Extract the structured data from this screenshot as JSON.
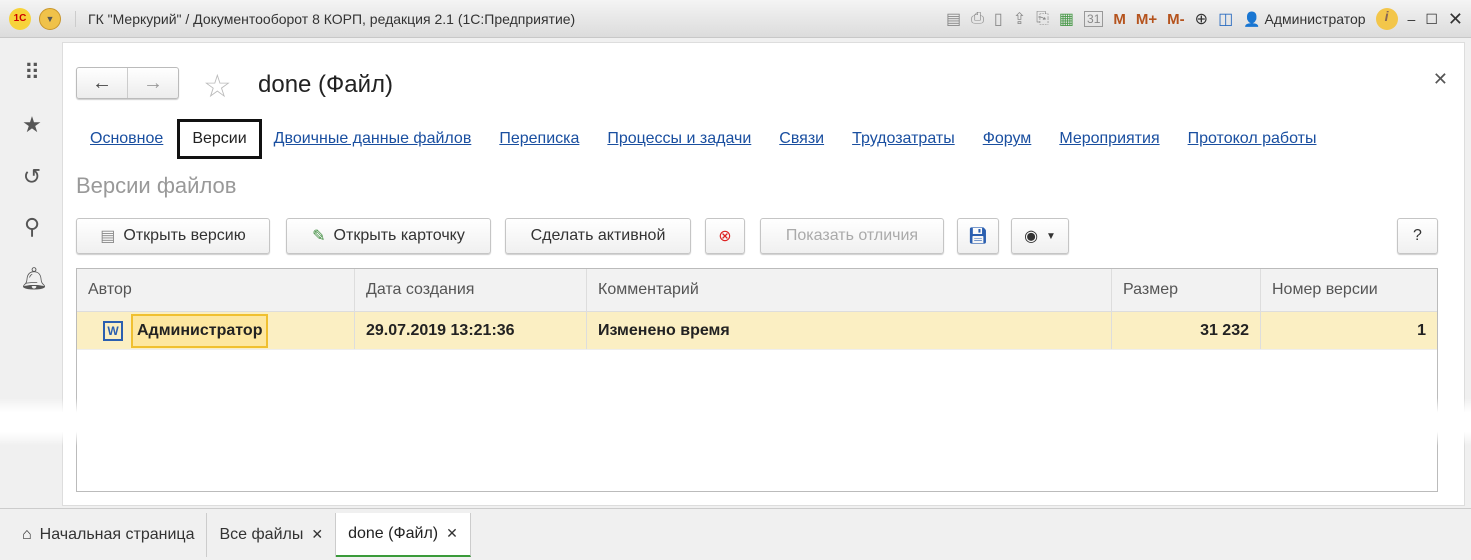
{
  "window": {
    "title": "ГК \"Меркурий\" / Документооборот 8 КОРП, редакция 2.1  (1С:Предприятие)",
    "logo": "1С",
    "user": "Администратор",
    "m": "M",
    "mplus": "M+",
    "mminus": "M-"
  },
  "form": {
    "title": "done (Файл)",
    "heading": "Версии файлов"
  },
  "tabs": [
    "Основное",
    "Версии",
    "Двоичные данные файлов",
    "Переписка",
    "Процессы и задачи",
    "Связи",
    "Трудозатраты",
    "Форум",
    "Мероприятия",
    "Протокол работы"
  ],
  "toolbar": {
    "open_version": "Открыть версию",
    "open_card": "Открыть карточку",
    "make_active": "Сделать активной",
    "show_diff": "Показать отличия",
    "help": "?"
  },
  "table": {
    "columns": [
      "Автор",
      "Дата создания",
      "Комментарий",
      "Размер",
      "Номер версии"
    ],
    "rows": [
      {
        "author": "Администратор",
        "date": "29.07.2019 13:21:36",
        "comment": "Изменено время",
        "size": "31 232",
        "version": "1",
        "icon": "W"
      }
    ]
  },
  "bottom_tabs": {
    "home": "Начальная страница",
    "all_files": "Все файлы",
    "current": "done (Файл)"
  }
}
